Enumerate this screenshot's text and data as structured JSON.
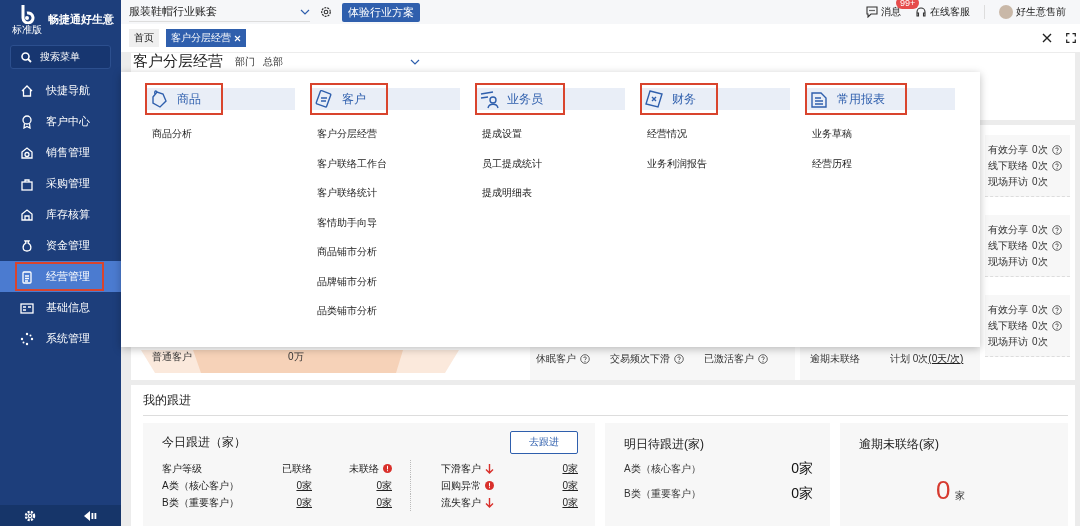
{
  "sidebar": {
    "brand": "畅捷通好生意",
    "edition": "标准版",
    "search": "搜索菜单",
    "items": [
      {
        "label": "快捷导航",
        "selected": false,
        "highlighted": false
      },
      {
        "label": "客户中心",
        "selected": false,
        "highlighted": false
      },
      {
        "label": "销售管理",
        "selected": false,
        "highlighted": false
      },
      {
        "label": "采购管理",
        "selected": false,
        "highlighted": false
      },
      {
        "label": "库存核算",
        "selected": false,
        "highlighted": false
      },
      {
        "label": "资金管理",
        "selected": false,
        "highlighted": false
      },
      {
        "label": "经营管理",
        "selected": true,
        "highlighted": true
      },
      {
        "label": "基础信息",
        "selected": false,
        "highlighted": false
      },
      {
        "label": "系统管理",
        "selected": false,
        "highlighted": false
      }
    ]
  },
  "topbar": {
    "account": "服装鞋帽行业账套",
    "trial_button": "体验行业方案",
    "messages": "消息",
    "message_badge": "99+",
    "support": "在线客服",
    "user": "好生意售前"
  },
  "tabs": [
    {
      "label": "首页",
      "selected": false,
      "closable": false
    },
    {
      "label": "客户分层经营",
      "selected": true,
      "closable": true
    }
  ],
  "page": {
    "title": "客户分层经营",
    "filter_label": "部门",
    "filter_value": "总部"
  },
  "menu": {
    "columns": [
      {
        "title": "商品",
        "highlighted": true,
        "items": [
          "商品分析"
        ]
      },
      {
        "title": "客户",
        "highlighted": true,
        "items": [
          "客户分层经营",
          "客户联络工作台",
          "客户联络统计",
          "客情助手向导",
          "商品铺市分析",
          "品牌铺市分析",
          "品类铺市分析"
        ]
      },
      {
        "title": "业务员",
        "highlighted": true,
        "items": [
          "提成设置",
          "员工提成统计",
          "提成明细表"
        ]
      },
      {
        "title": "财务",
        "highlighted": true,
        "items": [
          "经营情况",
          "业务利润报告"
        ]
      },
      {
        "title": "常用报表",
        "highlighted": true,
        "items": [
          "业务草稿",
          "经营历程"
        ]
      }
    ]
  },
  "stat_groups": [
    {
      "rows": [
        {
          "label": "有效分享",
          "value": "0次",
          "help": true
        },
        {
          "label": "线下联络",
          "value": "0次",
          "help": true
        },
        {
          "label": "现场拜访",
          "value": "0次",
          "help": false
        }
      ]
    },
    {
      "rows": [
        {
          "label": "有效分享",
          "value": "0次",
          "help": true
        },
        {
          "label": "线下联络",
          "value": "0次",
          "help": true
        },
        {
          "label": "现场拜访",
          "value": "0次",
          "help": false
        }
      ]
    },
    {
      "rows": [
        {
          "label": "有效分享",
          "value": "0次",
          "help": true
        },
        {
          "label": "线下联络",
          "value": "0次",
          "help": true
        },
        {
          "label": "现场拜访",
          "value": "0次",
          "help": false
        }
      ]
    }
  ],
  "level_row": {
    "name": "普通客户",
    "amount": "0万",
    "stats": [
      {
        "label": "休眠客户",
        "help": true
      },
      {
        "label": "交易频次下滑",
        "help": true
      },
      {
        "label": "已激活客户",
        "help": true
      }
    ],
    "overdue_label": "逾期未联络",
    "plan": "计划 0次",
    "plan_link": "(0天/次)"
  },
  "follow": {
    "title": "我的跟进",
    "today": {
      "title": "今日跟进（家）",
      "button": "去跟进",
      "headers": [
        {
          "label": "客户等级",
          "alert": false
        },
        {
          "label": "已联络",
          "alert": false
        },
        {
          "label": "未联络",
          "alert": true
        }
      ],
      "rows": [
        {
          "level": "A类（核心客户）",
          "contacted": "0家",
          "uncontacted": "0家"
        },
        {
          "level": "B类（重要客户）",
          "contacted": "0家",
          "uncontacted": "0家"
        }
      ],
      "signals": [
        {
          "label": "下滑客户",
          "kind": "down",
          "value": "0家"
        },
        {
          "label": "回购异常",
          "kind": "alert",
          "value": "0家"
        },
        {
          "label": "流失客户",
          "kind": "down",
          "value": "0家"
        }
      ]
    },
    "tomorrow": {
      "title": "明日待跟进(家)",
      "rows": [
        {
          "level": "A类（核心客户）",
          "value": "0家"
        },
        {
          "level": "B类（重要客户）",
          "value": "0家"
        }
      ]
    },
    "overdue": {
      "title": "逾期未联络(家)",
      "count": "0",
      "unit": "家"
    }
  }
}
